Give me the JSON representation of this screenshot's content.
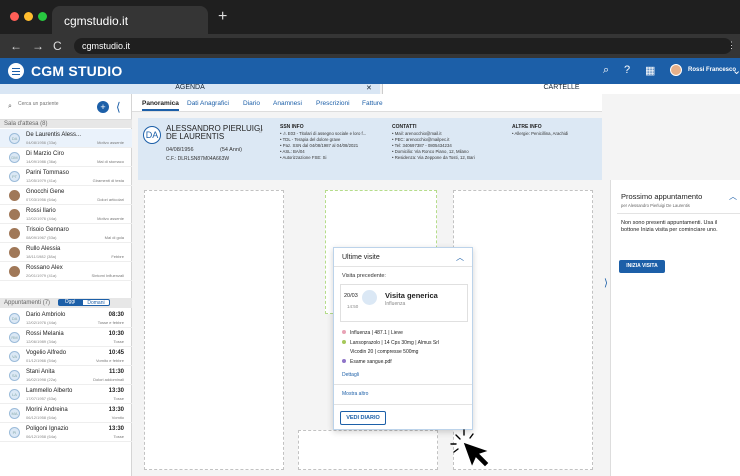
{
  "browser": {
    "tab_title": "cgmstudio.it",
    "url": "cgmstudio.it"
  },
  "app": {
    "brand": "CGM STUDIO",
    "user_name": "Rossi Francesco",
    "strip": {
      "agenda": "AGENDA",
      "close": "✕",
      "cartelle": "CARTELLE"
    }
  },
  "sidebar": {
    "search_placeholder": "Cerca un paziente",
    "waiting_header": "Sala d'attesa (8)",
    "waiting": [
      {
        "name": "De Laurentis Aless...",
        "dob": "04/08/1956 (33a)",
        "reason": "Motivo assente",
        "init": "DA",
        "photo": false,
        "selected": true
      },
      {
        "name": "Di Marzio Ciro",
        "dob": "14/09/1986 (36a)",
        "reason": "Mal di stomaco",
        "init": "DM",
        "photo": false
      },
      {
        "name": "Parini Tommaso",
        "dob": "12/05/1979 (41a)",
        "reason": "Giramenti di testa",
        "init": "PT",
        "photo": false
      },
      {
        "name": "Gnocchi Gene",
        "dob": "07/03/1956 (64a)",
        "reason": "Dolori articolari",
        "init": "GG",
        "photo": true
      },
      {
        "name": "Rossi Ilario",
        "dob": "12/02/1976 (44a)",
        "reason": "Motivo assente",
        "init": "RI",
        "photo": true
      },
      {
        "name": "Trisoio Gennaro",
        "dob": "08/09/1967 (53a)",
        "reason": "Mal di gola",
        "init": "TG",
        "photo": true
      },
      {
        "name": "Rullo Alessia",
        "dob": "18/11/1982 (38a)",
        "reason": "Febbre",
        "init": "RA",
        "photo": true
      },
      {
        "name": "Rossano Alex",
        "dob": "20/01/1979 (41a)",
        "reason": "Sintomi Influenzali",
        "init": "RA",
        "photo": true
      }
    ],
    "appointments_header": "Appuntamenti (7)",
    "today": "Oggi",
    "tomorrow": "Domani",
    "appointments": [
      {
        "name": "Dario Ambriolo",
        "dob": "12/02/1976 (44a)",
        "time": "08:30",
        "reason": "Tosse e febbre",
        "init": "DA"
      },
      {
        "name": "Rossi Melania",
        "dob": "12/06/1989 (34a)",
        "time": "10:30",
        "reason": "Tosse",
        "init": "RM"
      },
      {
        "name": "Vogelio Alfredo",
        "dob": "01/12/1966 (54a)",
        "time": "10:45",
        "reason": "Vomito e febbre",
        "init": "VA"
      },
      {
        "name": "Stani Anita",
        "dob": "16/02/1998 (22a)",
        "time": "11:30",
        "reason": "Dolori addominali",
        "init": "SA"
      },
      {
        "name": "Lammello Alberto",
        "dob": "17/07/1957 (63a)",
        "time": "13:30",
        "reason": "Tosse",
        "init": "LA"
      },
      {
        "name": "Morini Andreina",
        "dob": "06/12/1958 (64a)",
        "time": "13:30",
        "reason": "Vomito",
        "init": "MA"
      },
      {
        "name": "Poligoni Ignazio",
        "dob": "06/12/1958 (64a)",
        "time": "13:30",
        "reason": "Tosse",
        "init": "PI"
      }
    ]
  },
  "tabs": [
    "Panoramica",
    "Dati Anagrafici",
    "Diario",
    "Anamnesi",
    "Prescrizioni",
    "Fatture"
  ],
  "patient": {
    "initials": "DA",
    "name_line1": "ALESSANDRO PIERLUIGI",
    "name_line2": "DE LAURENTIS",
    "dob": "04/08/1956",
    "age": "(54 Anni)",
    "cf": "C.F.: DLRLSN87M04A663W",
    "gender": "♂"
  },
  "ssn": {
    "title": "SSN INFO",
    "lines": [
      "• ⚠ E03 - Titolari di assegno sociale e loro f...",
      "• TDL - Terapia del dolore grave",
      "• Paz. SSN dal 04/08/1987 al 04/08/2021",
      "• ASL: BA/04",
      "• Autorizzazione FSE: Si"
    ]
  },
  "contacts": {
    "title": "CONTATTI",
    "lines": [
      "• Mail: arenocchio@mail.it",
      "• PEC: arenocchio@mailpec.it",
      "• Tel: 340697387 - 0805434234",
      "• Domicilio: Via Ronco Piano, 12, Milano",
      "• Residenza: Via Zeppone da Tosti, 12, Bari"
    ]
  },
  "other": {
    "title": "ALTRE INFO",
    "lines": [
      "• Allergie: Penicillina, Arachidi"
    ]
  },
  "visits_card": {
    "title": "Ultime visite",
    "prev": "Visita precedente:",
    "date": "20/03",
    "time": "14:50",
    "visit_title": "Visita generica",
    "visit_sub": "Influenza",
    "items": [
      {
        "text": "Influenza | 487.1 | Lieve",
        "color": "#e8a3b6"
      },
      {
        "text": "Lansoprazolo | 14 Cps 30mg | Almus Srl",
        "color": "#a5c85a"
      },
      {
        "text": "Vicodin 20 | compresse 500mg",
        "color": ""
      },
      {
        "text": "Esame sangue.pdf",
        "color": "#8f74c8"
      }
    ],
    "details": "Dettagli",
    "more": "Mostra altro",
    "diary_btn": "VEDI DIARIO"
  },
  "next_appointment": {
    "title": "Prossimo appuntamento",
    "sub": "per Alessandro Pierluigi De Laurentis",
    "message": "Non sono presenti appuntamenti. Usa il bottone Inizia visita per cominciare uno.",
    "button": "INIZIA VISITA"
  }
}
